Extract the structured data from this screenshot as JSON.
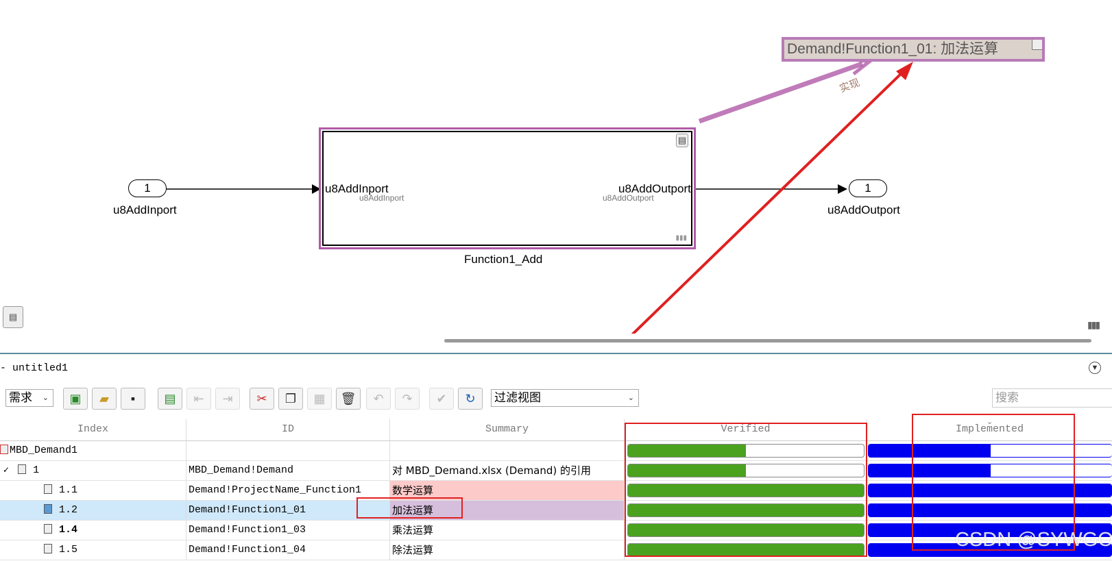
{
  "diagram": {
    "inport": {
      "number": "1",
      "name": "u8AddInport"
    },
    "outport": {
      "number": "1",
      "name": "u8AddOutport"
    },
    "subsystem": {
      "name": "Function1_Add",
      "inner_inport_label": "u8AddInport",
      "inner_outport_label": "u8AddOutport",
      "inner_inport_sublabel": "u8AddInport",
      "inner_outport_sublabel": "u8AddOutport"
    },
    "annotation": {
      "text": "Demand!Function1_01: 加法运算",
      "link_label": "实现"
    },
    "colors": {
      "link_magenta": "#b05aa8",
      "arrow_red": "#e02020"
    }
  },
  "panel": {
    "title": "- untitled1",
    "view_dropdown": "需求",
    "filter_dropdown": "过滤视图",
    "search_placeholder": "搜索",
    "toolbar_icons": [
      "new-requirement-set-icon",
      "open-folder-icon",
      "save-icon",
      "add-requirement-icon",
      "outdent-icon",
      "indent-icon",
      "cut-icon",
      "copy-icon",
      "paste-icon",
      "delete-icon",
      "undo-icon",
      "redo-icon",
      "check-icon",
      "refresh-icon"
    ]
  },
  "table": {
    "columns": [
      "Index",
      "ID",
      "Summary",
      "Verified",
      "Implemented"
    ],
    "rows": [
      {
        "index": "MBD_Demand1",
        "id": "",
        "summary": "",
        "verified": 0.5,
        "implemented": 0.5
      },
      {
        "index": "1",
        "id": "MBD_Demand!Demand",
        "summary": "对 MBD_Demand.xlsx (Demand) 的引用",
        "verified": 0.5,
        "implemented": 0.5
      },
      {
        "index": "1.1",
        "id": "Demand!ProjectName_Function1",
        "summary": "数学运算",
        "verified": 1.0,
        "implemented": 1.0
      },
      {
        "index": "1.2",
        "id": "Demand!Function1_01",
        "summary": "加法运算",
        "verified": 1.0,
        "implemented": 1.0
      },
      {
        "index": "1.4",
        "id": "Demand!Function1_03",
        "summary": "乘法运算",
        "verified": 1.0,
        "implemented": 1.0
      },
      {
        "index": "1.5",
        "id": "Demand!Function1_04",
        "summary": "除法运算",
        "verified": 1.0,
        "implemented": 1.0
      }
    ],
    "colors": {
      "verified": "#4aa21f",
      "implemented": "#0000f0",
      "selected_row": "#cfe8fa",
      "summary_pink": "#fdcaca",
      "summary_purple": "#d6bfdc"
    }
  },
  "watermark": "CSDN @SYWGO"
}
